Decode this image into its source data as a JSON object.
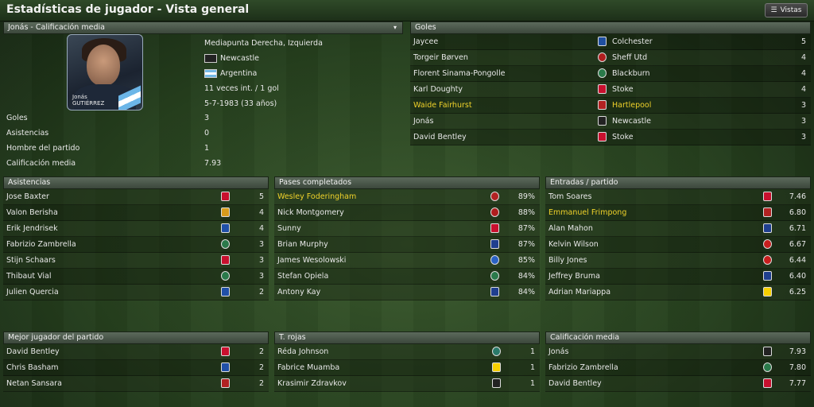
{
  "window": {
    "title": "Estadísticas de jugador - Vista general",
    "vistas_label": "Vistas"
  },
  "player": {
    "header": "Jonás - Calificación media",
    "photo_first": "Jonás",
    "photo_last": "GUTIÉRREZ",
    "position": "Mediapunta Derecha, Izquierda",
    "club": "Newcastle",
    "nation": "Argentina",
    "caps": "11 veces int. / 1 gol",
    "dob": "5-7-1983 (33 años)",
    "stats": [
      {
        "label": "Goles",
        "value": "3"
      },
      {
        "label": "Asistencias",
        "value": "0"
      },
      {
        "label": "Hombre del partido",
        "value": "1"
      },
      {
        "label": "Calificación media",
        "value": "7.93"
      }
    ]
  },
  "goles": {
    "header": "Goles",
    "rows": [
      {
        "name": "Jaycee",
        "team": "Colchester",
        "value": "5",
        "hl": false
      },
      {
        "name": "Torgeir Børven",
        "team": "Sheff Utd",
        "value": "4",
        "hl": false
      },
      {
        "name": "Florent Sinama-Pongolle",
        "team": "Blackburn",
        "value": "4",
        "hl": false
      },
      {
        "name": "Karl Doughty",
        "team": "Stoke",
        "value": "4",
        "hl": false
      },
      {
        "name": "Waide Fairhurst",
        "team": "Hartlepool",
        "value": "3",
        "hl": true
      },
      {
        "name": "Jonás",
        "team": "Newcastle",
        "value": "3",
        "hl": false
      },
      {
        "name": "David Bentley",
        "team": "Stoke",
        "value": "3",
        "hl": false
      }
    ]
  },
  "asistencias": {
    "header": "Asistencias",
    "rows": [
      {
        "name": "Jose Baxter",
        "value": "5",
        "hl": false
      },
      {
        "name": "Valon Berisha",
        "value": "4",
        "hl": false
      },
      {
        "name": "Erik Jendrisek",
        "value": "4",
        "hl": false
      },
      {
        "name": "Fabrizio Zambrella",
        "value": "3",
        "hl": false
      },
      {
        "name": "Stijn Schaars",
        "value": "3",
        "hl": false
      },
      {
        "name": "Thibaut Vial",
        "value": "3",
        "hl": false
      },
      {
        "name": "Julien Quercia",
        "value": "2",
        "hl": false
      }
    ]
  },
  "pases": {
    "header": "Pases completados",
    "rows": [
      {
        "name": "Wesley Foderingham",
        "value": "89%",
        "hl": true
      },
      {
        "name": "Nick Montgomery",
        "value": "88%",
        "hl": false
      },
      {
        "name": "Sunny",
        "value": "87%",
        "hl": false
      },
      {
        "name": "Brian Murphy",
        "value": "87%",
        "hl": false
      },
      {
        "name": "James Wesolowski",
        "value": "85%",
        "hl": false
      },
      {
        "name": "Stefan Opiela",
        "value": "84%",
        "hl": false
      },
      {
        "name": "Antony Kay",
        "value": "84%",
        "hl": false
      }
    ]
  },
  "entradas": {
    "header": "Entradas / partido",
    "rows": [
      {
        "name": "Tom Soares",
        "value": "7.46",
        "hl": false
      },
      {
        "name": "Emmanuel Frimpong",
        "value": "6.80",
        "hl": true
      },
      {
        "name": "Alan Mahon",
        "value": "6.71",
        "hl": false
      },
      {
        "name": "Kelvin Wilson",
        "value": "6.67",
        "hl": false
      },
      {
        "name": "Billy Jones",
        "value": "6.44",
        "hl": false
      },
      {
        "name": "Jeffrey Bruma",
        "value": "6.40",
        "hl": false
      },
      {
        "name": "Adrian Mariappa",
        "value": "6.25",
        "hl": false
      }
    ]
  },
  "mejor": {
    "header": "Mejor jugador del partido",
    "rows": [
      {
        "name": "David Bentley",
        "value": "2",
        "hl": false
      },
      {
        "name": "Chris Basham",
        "value": "2",
        "hl": false
      },
      {
        "name": "Netan Sansara",
        "value": "2",
        "hl": false
      }
    ]
  },
  "rojas": {
    "header": "T. rojas",
    "rows": [
      {
        "name": "Réda Johnson",
        "value": "1",
        "hl": false
      },
      {
        "name": "Fabrice Muamba",
        "value": "1",
        "hl": false
      },
      {
        "name": "Krasimir Zdravkov",
        "value": "1",
        "hl": false
      }
    ]
  },
  "calificacion": {
    "header": "Calificación media",
    "rows": [
      {
        "name": "Jonás",
        "value": "7.93",
        "hl": false
      },
      {
        "name": "Fabrizio Zambrella",
        "value": "7.80",
        "hl": false
      },
      {
        "name": "David Bentley",
        "value": "7.77",
        "hl": false
      }
    ]
  },
  "crest_colors": {
    "stoke": "#c8102e",
    "newcastle": "#222222",
    "blackburn": "#2a7a4a",
    "colchester": "#1f4fa0",
    "sheff": "#b01e1e",
    "hartlepool": "#b22222",
    "hull": "#d99c1c",
    "birmingham": "#2050a8",
    "ipswich": "#1f3f8f",
    "leicester": "#2a62c4",
    "watford": "#f6d000",
    "charlton": "#c81e1e"
  }
}
